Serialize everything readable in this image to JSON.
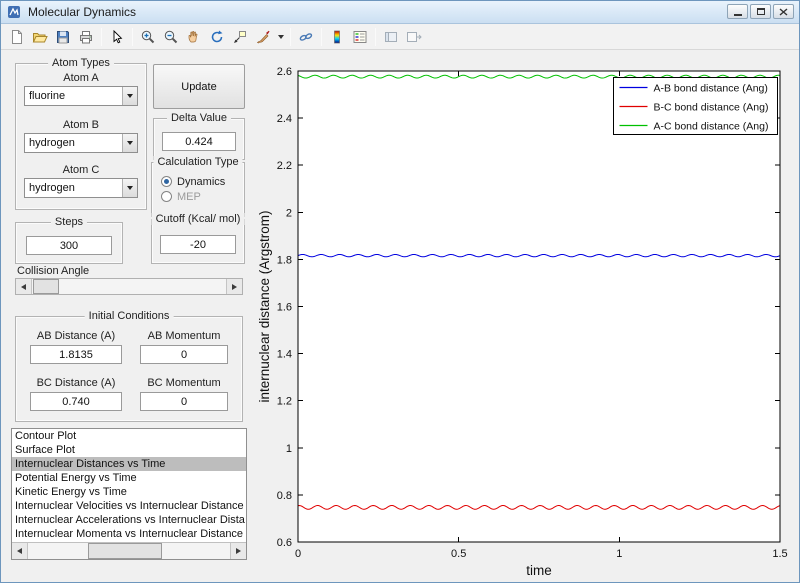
{
  "window": {
    "title": "Molecular Dynamics"
  },
  "toolbar": {
    "icon_names": [
      "new-file",
      "open-folder",
      "save",
      "print",
      "edit-plot",
      "zoom-in",
      "zoom-out",
      "pan",
      "rotate-3d",
      "data-cursor",
      "brush",
      "brush-dropdown",
      "link-plots",
      "insert-colorbar",
      "insert-legend",
      "hide-plot-tools",
      "show-plot-tools"
    ]
  },
  "panels": {
    "atom_types": {
      "title": "Atom Types",
      "atoms": [
        {
          "label": "Atom A",
          "value": "fluorine"
        },
        {
          "label": "Atom B",
          "value": "hydrogen"
        },
        {
          "label": "Atom C",
          "value": "hydrogen"
        }
      ]
    },
    "update_button_label": "Update",
    "delta": {
      "title": "Delta Value",
      "value": "0.424"
    },
    "calc_type": {
      "title": "Calculation Type",
      "options": [
        {
          "label": "Dynamics",
          "selected": true
        },
        {
          "label": "MEP",
          "selected": false
        }
      ]
    },
    "steps": {
      "title": "Steps",
      "value": "300"
    },
    "cutoff": {
      "title": "Cutoff (Kcal/ mol)",
      "value": "-20"
    },
    "collision_angle_label": "Collision Angle",
    "initial_conditions": {
      "title": "Initial Conditions",
      "fields": [
        {
          "label": "AB Distance (A)",
          "value": "1.8135"
        },
        {
          "label": "AB Momentum",
          "value": "0"
        },
        {
          "label": "BC Distance (A)",
          "value": "0.740"
        },
        {
          "label": "BC Momentum",
          "value": "0"
        }
      ]
    },
    "plot_list": {
      "items": [
        "Contour Plot",
        "Surface Plot",
        "Internuclear Distances vs Time",
        "Potential Energy vs Time",
        "Kinetic Energy vs Time",
        "Internuclear Velocities vs Internuclear Distance",
        "Internuclear Accelerations vs Internuclear Dista",
        "Internuclear Momenta vs Internuclear Distance"
      ],
      "selected_index": 2
    }
  },
  "chart_data": {
    "type": "line",
    "xlabel": "time",
    "ylabel": "internuclear distance (Argstrom)",
    "xlim": [
      0,
      1.5
    ],
    "ylim": [
      0.6,
      2.6
    ],
    "xticks": [
      0,
      0.5,
      1,
      1.5
    ],
    "yticks": [
      0.6,
      0.8,
      1,
      1.2,
      1.4,
      1.6,
      1.8,
      2,
      2.2,
      2.4,
      2.6
    ],
    "grid": false,
    "legend_position": "top-right",
    "series": [
      {
        "name": "A-B bond distance (Ang)",
        "color": "#0000E0",
        "mean": 1.816,
        "amplitude": 0.005,
        "cycles": 26,
        "phase": 0
      },
      {
        "name": "B-C bond distance (Ang)",
        "color": "#E00000",
        "mean": 0.747,
        "amplitude": 0.008,
        "cycles": 26,
        "phase": 1.2
      },
      {
        "name": "A-C bond distance (Ang)",
        "color": "#00C000",
        "mean": 2.576,
        "amplitude": 0.006,
        "cycles": 26,
        "phase": 2.1
      }
    ]
  }
}
